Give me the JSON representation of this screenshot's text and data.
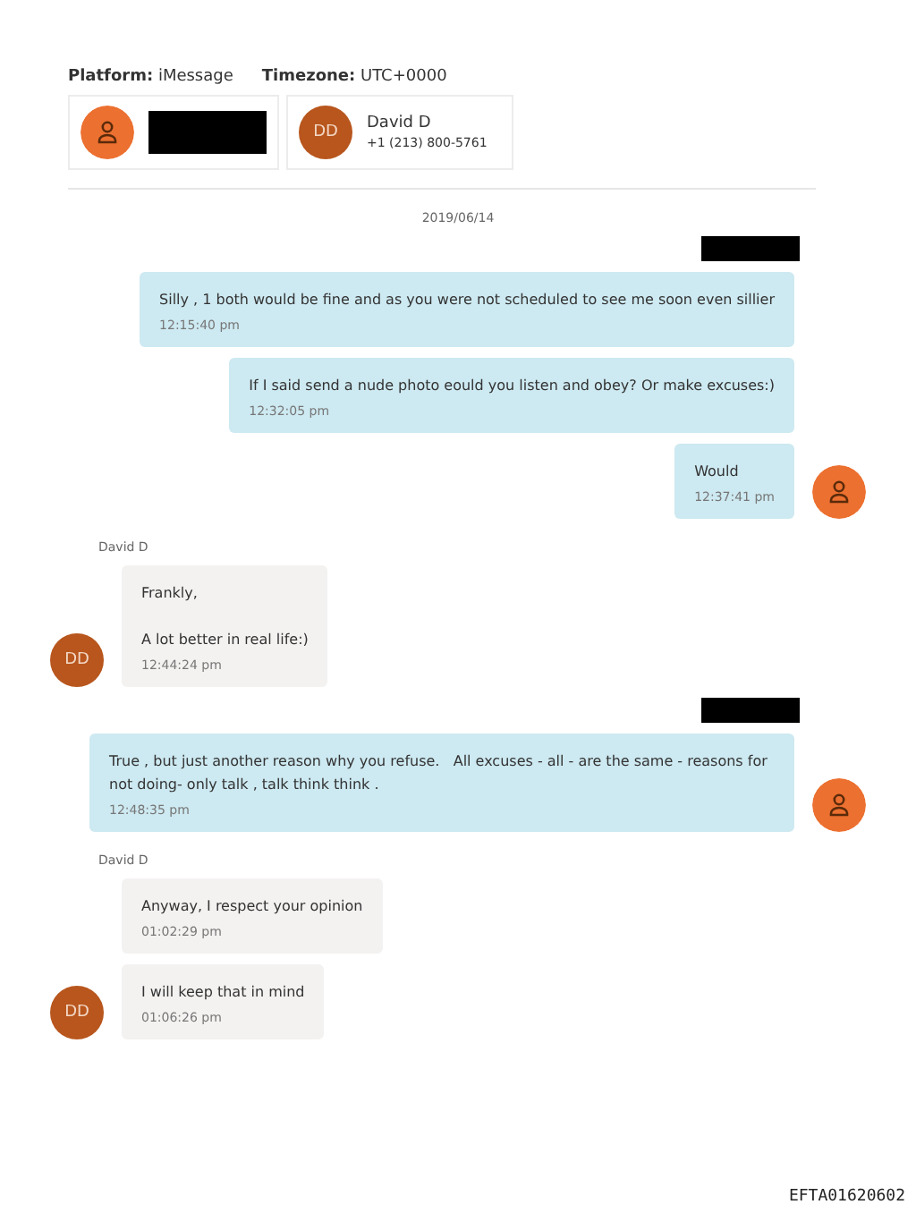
{
  "header": {
    "platform_label": "Platform:",
    "platform": "iMessage",
    "timezone_label": "Timezone:",
    "timezone": "UTC+0000"
  },
  "participants": [
    {
      "kind": "owner",
      "redacted": true
    },
    {
      "kind": "contact",
      "initials": "DD",
      "name": "David D",
      "phone": "+1 (213) 800-5761"
    }
  ],
  "date": "2019/06/14",
  "groups": [
    {
      "kind": "outgoing",
      "sender_redacted": true,
      "messages": [
        {
          "text": "Silly , 1 both would be fine and as you were not scheduled to see me soon even sillier",
          "time": "12:15:40 pm"
        },
        {
          "text": "If I said send a nude photo eould you listen and obey? Or make excuses:)",
          "time": "12:32:05 pm"
        },
        {
          "text": "Would",
          "time": "12:37:41 pm"
        }
      ]
    },
    {
      "kind": "incoming",
      "sender": "David D",
      "initials": "DD",
      "messages": [
        {
          "text": "Frankly,\n\nA lot better in real life:)",
          "time": "12:44:24 pm"
        }
      ]
    },
    {
      "kind": "outgoing",
      "sender_redacted": true,
      "messages": [
        {
          "text": "True , but just another reason why you refuse.   All excuses - all - are the same - reasons for not doing- only talk , talk think think .",
          "time": "12:48:35 pm"
        }
      ]
    },
    {
      "kind": "incoming",
      "sender": "David D",
      "initials": "DD",
      "messages": [
        {
          "text": "Anyway, I respect your opinion",
          "time": "01:02:29 pm"
        },
        {
          "text": "I will keep that in mind",
          "time": "01:06:26 pm"
        }
      ]
    }
  ],
  "footer": "EFTA01620602"
}
